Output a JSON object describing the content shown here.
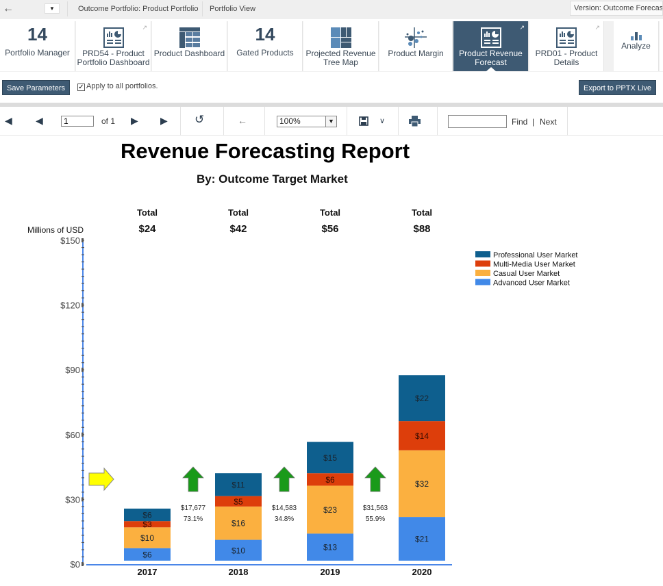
{
  "topbar": {
    "breadcrumbs": [
      "Outcome Portfolio:  Product Portfolio",
      "Portfolio View"
    ],
    "version": "Version: Outcome Forecast ▼"
  },
  "tiles": [
    {
      "label": "Portfolio Manager",
      "number": "14",
      "icon": "number"
    },
    {
      "label": "PRD54 - Product Portfolio Dashboard",
      "icon": "report-icon",
      "external": true
    },
    {
      "label": "Product Dashboard",
      "icon": "table-icon"
    },
    {
      "label": "Gated Products",
      "number": "14",
      "icon": "number"
    },
    {
      "label": "Projected Revenue Tree Map",
      "icon": "treemap-icon"
    },
    {
      "label": "Product Margin",
      "icon": "scatter-icon"
    },
    {
      "label": "Product Revenue Forecast",
      "icon": "report-icon",
      "external": true,
      "active": true
    },
    {
      "label": "PRD01 - Product Details",
      "icon": "report-icon",
      "external": true
    },
    {
      "label": "Analyze",
      "icon": "bar-chart-icon"
    }
  ],
  "params": {
    "save_label": "Save Parameters",
    "apply_label": "Apply to all portfolios.",
    "apply_checked": true,
    "export_label": "Export to PPTX Live"
  },
  "toolbar": {
    "page_value": "1",
    "of_label": "of 1",
    "zoom_value": "100%",
    "find_value": "",
    "find_label": "Find",
    "sep": "|",
    "next_label": "Next"
  },
  "report": {
    "title": "Revenue Forecasting Report",
    "subtitle": "By: Outcome Target Market"
  },
  "chart_data": {
    "type": "bar",
    "stacked": true,
    "title": "Revenue Forecasting Report",
    "subtitle": "By: Outcome Target Market",
    "ylabel": "Millions of USD",
    "xlabel": "",
    "ylim": [
      0,
      150
    ],
    "yticks": [
      0,
      30,
      60,
      90,
      120,
      150
    ],
    "ytick_labels": [
      "$0",
      "$30",
      "$60",
      "$90",
      "$120",
      "$150"
    ],
    "categories": [
      "2017",
      "2018",
      "2019",
      "2020"
    ],
    "totals_header": "Total",
    "totals": [
      "$24",
      "$42",
      "$56",
      "$88"
    ],
    "series": [
      {
        "name": "Advanced User Market",
        "color": "#4189e8",
        "values": [
          6,
          10,
          13,
          21
        ]
      },
      {
        "name": "Casual User Market",
        "color": "#fbb040",
        "values": [
          10,
          16,
          23,
          32
        ]
      },
      {
        "name": "Multi-Media User Market",
        "color": "#dd3e0b",
        "values": [
          3,
          5,
          6,
          14
        ]
      },
      {
        "name": "Professional User Market",
        "color": "#0e5f8e",
        "values": [
          6,
          11,
          15,
          22
        ]
      }
    ],
    "legend_order": [
      "Professional User Market",
      "Multi-Media User Market",
      "Casual User Market",
      "Advanced User Market"
    ],
    "legend": "right",
    "growth_annotations": [
      {
        "between": [
          "2017",
          "2018"
        ],
        "amount": "$17,677",
        "percent": "73.1%",
        "direction": "up"
      },
      {
        "between": [
          "2018",
          "2019"
        ],
        "amount": "$14,583",
        "percent": "34.8%",
        "direction": "up"
      },
      {
        "between": [
          "2019",
          "2020"
        ],
        "amount": "$31,563",
        "percent": "55.9%",
        "direction": "up"
      }
    ],
    "start_indicator": "right-arrow",
    "colors": {
      "up_arrow": "#1a9a1a",
      "start_arrow": "#ffff00",
      "axis": "#4a86e8"
    }
  }
}
